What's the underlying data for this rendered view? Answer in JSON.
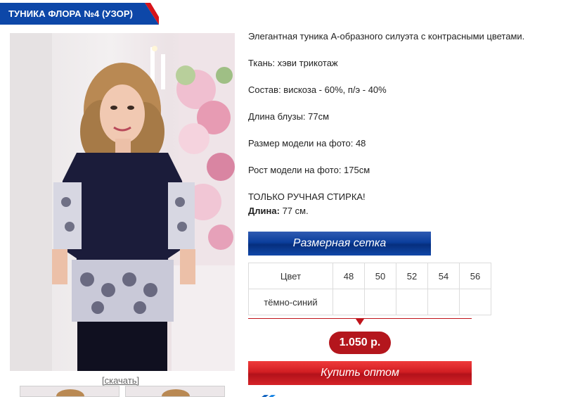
{
  "product": {
    "title": "ТУНИКА ФЛОРА №4 (УЗОР)",
    "download_label": "[скачать]",
    "description": [
      "Элегантная туника А-образного силуэта с контрасными цветами.",
      "Ткань: хэви трикотаж",
      "Состав: вискоза - 60%, п/э - 40%",
      "Длина блузы: 77см",
      "Размер модели на фото: 48",
      "Рост модели на фото: 175см",
      "ТОЛЬКО РУЧНАЯ СТИРКА!"
    ],
    "length_label": "Длина:",
    "length_value": "77 см."
  },
  "size_chart": {
    "header": "Размерная сетка",
    "color_label": "Цвет",
    "sizes": [
      "48",
      "50",
      "52",
      "54",
      "56"
    ],
    "row_color": "тёмно-синий"
  },
  "price": "1.050 р.",
  "buy_button": "Купить оптом",
  "colors": {
    "accent_blue": "#0b3e9c",
    "accent_red": "#c0141b",
    "price_bg": "#b4161d"
  }
}
